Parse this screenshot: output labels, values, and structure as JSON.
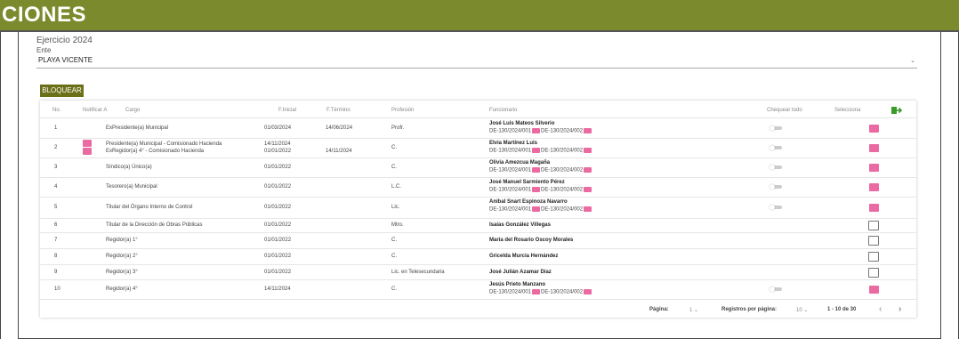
{
  "header": {
    "title": "CIONES"
  },
  "form": {
    "ejercicio": "Ejercicio 2024",
    "ente_label": "Ente",
    "ente_value": "PLAYA VICENTE"
  },
  "actions": {
    "bloquear": "BLOQUEAR"
  },
  "table": {
    "headers": {
      "no": "No.",
      "notificar": "Notificar A",
      "cargo": "Cargo",
      "finicial": "F.Inicial",
      "ftermino": "F.Término",
      "profesion": "Profesión",
      "funcionario": "Funcionario",
      "chequear": "Chequear todo",
      "selecciona": "Selecciona"
    },
    "rows": [
      {
        "no": "1",
        "cargo": "ExPresidente(a) Municipal",
        "cargo2": "",
        "finicial": "01/03/2024",
        "finicial2": "",
        "ftermino": "14/06/2024",
        "profesion": "Profr.",
        "funcionario": "José Luis Mateos Silverio",
        "doc1": "DE-130/2024/001",
        "doc2": "DE-130/2024/002",
        "notify": false,
        "toggle": true,
        "selected": true
      },
      {
        "no": "2",
        "cargo": "Presidente(a) Municipal - Comisionado Hacienda",
        "cargo2": "ExRegidor(a) 4° - Comisionado Hacienda",
        "finicial": "14/11/2024",
        "finicial2": "01/01/2022",
        "ftermino": "14/11/2024",
        "profesion": "C.",
        "funcionario": "Elvia Martínez Luis",
        "doc1": "DE-130/2024/001",
        "doc2": "DE-130/2024/002",
        "notify": true,
        "toggle": true,
        "selected": true
      },
      {
        "no": "3",
        "cargo": "Síndico(a) Único(a)",
        "cargo2": "",
        "finicial": "01/01/2022",
        "finicial2": "",
        "ftermino": "",
        "profesion": "C.",
        "funcionario": "Olivia Amezcua Magaña",
        "doc1": "DE-130/2024/001",
        "doc2": "DE-130/2024/002",
        "notify": false,
        "toggle": true,
        "selected": true
      },
      {
        "no": "4",
        "cargo": "Tesorero(a) Municipal",
        "cargo2": "",
        "finicial": "01/01/2022",
        "finicial2": "",
        "ftermino": "",
        "profesion": "L.C.",
        "funcionario": "José Manuel Sarmiento Pérez",
        "doc1": "DE-130/2024/001",
        "doc2": "DE-130/2024/002",
        "notify": false,
        "toggle": true,
        "selected": true
      },
      {
        "no": "5",
        "cargo": "Titular del Órgano Interno de Control",
        "cargo2": "",
        "finicial": "01/01/2022",
        "finicial2": "",
        "ftermino": "",
        "profesion": "Lic.",
        "funcionario": "Aníbal Snart Espinoza Navarro",
        "doc1": "DE-130/2024/001",
        "doc2": "DE-130/2024/002",
        "notify": false,
        "toggle": true,
        "selected": true
      },
      {
        "no": "6",
        "cargo": "Titular de la Dirección de Obras Públicas",
        "cargo2": "",
        "finicial": "01/01/2022",
        "finicial2": "",
        "ftermino": "",
        "profesion": "Mtro.",
        "funcionario": "Isaías González Villegas",
        "doc1": "",
        "doc2": "",
        "notify": false,
        "toggle": false,
        "selected": false
      },
      {
        "no": "7",
        "cargo": "Regidor(a) 1°",
        "cargo2": "",
        "finicial": "01/01/2022",
        "finicial2": "",
        "ftermino": "",
        "profesion": "C.",
        "funcionario": "María del Rosario Oscoy Morales",
        "doc1": "",
        "doc2": "",
        "notify": false,
        "toggle": false,
        "selected": false
      },
      {
        "no": "8",
        "cargo": "Regidor(a) 2°",
        "cargo2": "",
        "finicial": "01/01/2022",
        "finicial2": "",
        "ftermino": "",
        "profesion": "C.",
        "funcionario": "Gricelda Murcia Hernández",
        "doc1": "",
        "doc2": "",
        "notify": false,
        "toggle": false,
        "selected": false
      },
      {
        "no": "9",
        "cargo": "Regidor(a) 3°",
        "cargo2": "",
        "finicial": "01/01/2022",
        "finicial2": "",
        "ftermino": "",
        "profesion": "Lic. en Telesecundaria",
        "funcionario": "José Julián Azamar Díaz",
        "doc1": "",
        "doc2": "",
        "notify": false,
        "toggle": false,
        "selected": false
      },
      {
        "no": "10",
        "cargo": "Regidor(a) 4°",
        "cargo2": "",
        "finicial": "14/11/2024",
        "finicial2": "",
        "ftermino": "",
        "profesion": "C.",
        "funcionario": "Jesús Prieto Manzano",
        "doc1": "DE-130/2024/001",
        "doc2": "DE-130/2024/002",
        "notify": false,
        "toggle": true,
        "selected": true
      }
    ]
  },
  "pagination": {
    "page_label": "Página:",
    "page_value": "1",
    "per_page_label": "Registros por página:",
    "per_page_value": "10",
    "range": "1 - 10 de 30",
    "prev": "‹",
    "next": "›"
  },
  "colors": {
    "header_bg": "#7a8a2c",
    "button_bg": "#6b6f18",
    "pink": "#ea6aa1",
    "export_icon": "#3a9a2a"
  },
  "icons": {
    "export": "file-export-icon"
  }
}
